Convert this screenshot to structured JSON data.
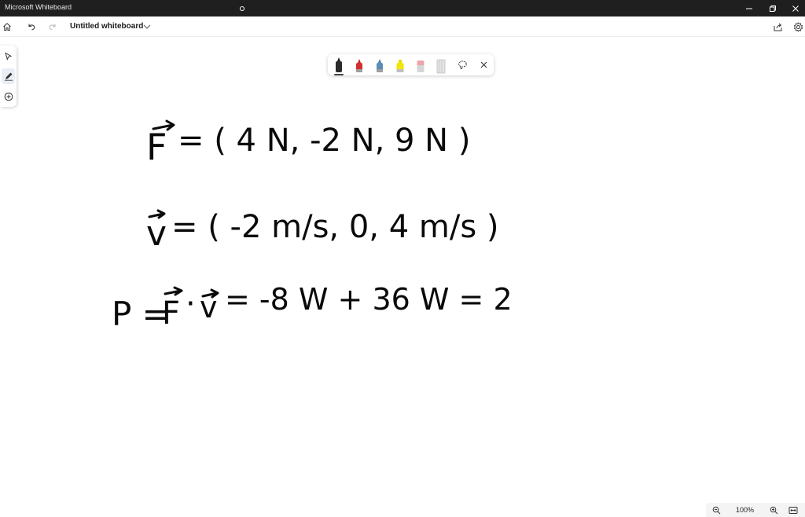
{
  "window": {
    "app_title": "Microsoft Whiteboard"
  },
  "header": {
    "document_title": "Untitled whiteboard",
    "home_icon": "home-icon",
    "undo_icon": "undo-icon",
    "redo_icon": "redo-icon",
    "share_icon": "share-icon",
    "settings_icon": "settings-icon"
  },
  "rail": {
    "tools": [
      "select-icon",
      "pen-icon",
      "add-icon"
    ],
    "active_tool": "pen"
  },
  "pen_tray": {
    "pens": [
      {
        "name": "black-pen",
        "color": "#1a1a1a",
        "selected": true
      },
      {
        "name": "red-pen",
        "color": "#d32f2f",
        "selected": false
      },
      {
        "name": "blue-pen",
        "color": "#4a7ea8",
        "selected": false
      },
      {
        "name": "yellow-highlighter",
        "color": "#f2e600",
        "selected": false
      },
      {
        "name": "eraser",
        "color": "#f0a4a8",
        "selected": false
      },
      {
        "name": "ruler",
        "color": "#d0d0d0",
        "selected": false
      }
    ],
    "lasso_icon": "lasso-icon",
    "close_icon": "close-icon"
  },
  "canvas": {
    "line1": {
      "lhs": "F",
      "rhs": "= ( 4 N, -2 N, 9 N )"
    },
    "line2": {
      "lhs": "v",
      "rhs": "= ( -2 m/s, 0, 4 m/s )"
    },
    "line3": {
      "p": "P =",
      "f": "F",
      "dot": "·",
      "v": "v",
      "rhs": "= -8 W + 36 W = 2"
    }
  },
  "zoom": {
    "level": "100%"
  }
}
